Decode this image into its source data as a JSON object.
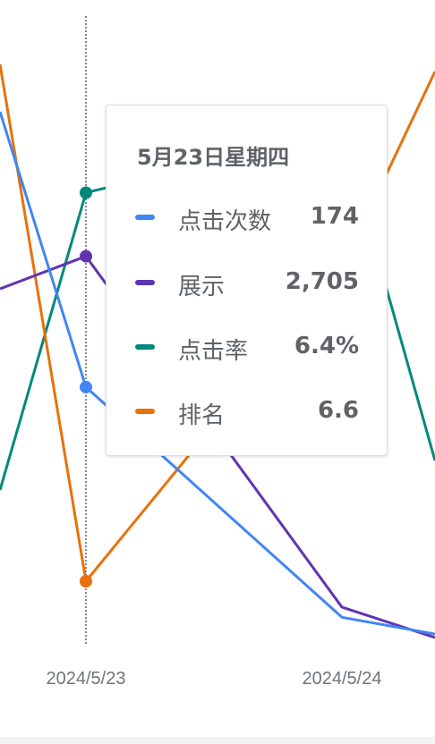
{
  "chart_data": {
    "type": "line",
    "categories": [
      "2024/5/23",
      "2024/5/24"
    ],
    "series": [
      {
        "name": "点击次数",
        "color": "#4285f4",
        "values": [
          174,
          18
        ]
      },
      {
        "name": "展示",
        "color": "#5e35b1",
        "values": [
          2705,
          210
        ]
      },
      {
        "name": "点击率",
        "color": "#00897b",
        "values": [
          6.4,
          8.6
        ]
      },
      {
        "name": "排名",
        "color": "#e8710a",
        "values": [
          6.6,
          6.1
        ]
      }
    ],
    "hovered_category": "2024/5/23"
  },
  "tooltip": {
    "title": "5月23日星期四",
    "rows": [
      {
        "label": "点击次数",
        "value": "174",
        "color": "#4285f4"
      },
      {
        "label": "展示",
        "value": "2,705",
        "color": "#5e35b1"
      },
      {
        "label": "点击率",
        "value": "6.4%",
        "color": "#00897b"
      },
      {
        "label": "排名",
        "value": "6.6",
        "color": "#e8710a"
      }
    ]
  },
  "x_ticks": [
    "2024/5/23",
    "2024/5/24"
  ]
}
